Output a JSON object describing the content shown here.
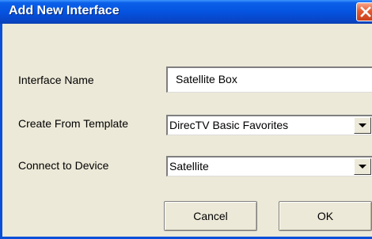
{
  "dialog": {
    "title": "Add New Interface",
    "close_icon": "close-icon"
  },
  "form": {
    "interface_name": {
      "label": "Interface Name",
      "value": "Satellite Box"
    },
    "template": {
      "label": "Create From Template",
      "selected": "DirecTV Basic Favorites"
    },
    "device": {
      "label": "Connect to Device",
      "selected": "Satellite"
    }
  },
  "buttons": {
    "cancel": "Cancel",
    "ok": "OK"
  },
  "colors": {
    "titlebar": "#0553e0",
    "dialog_background": "#ece9d8",
    "close_button": "#e45a2f"
  }
}
